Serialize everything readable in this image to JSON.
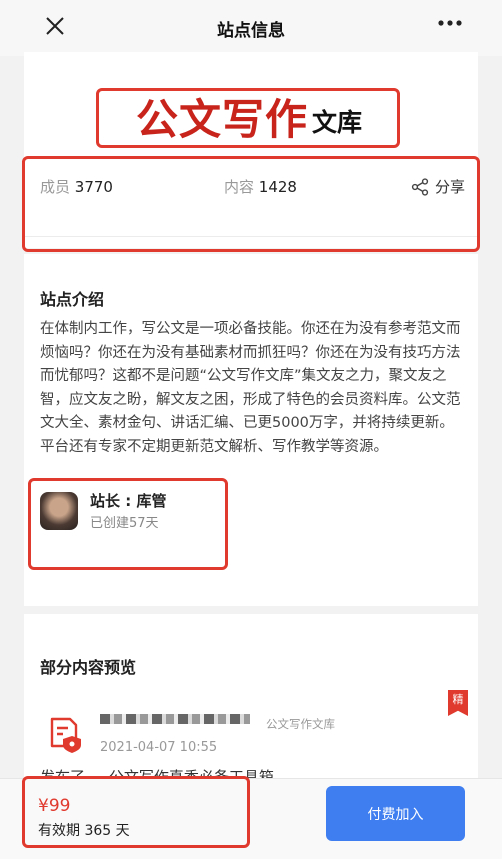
{
  "topbar": {
    "title": "站点信息",
    "close_icon": "close-icon",
    "more_icon": "more-icon"
  },
  "logo": {
    "main": "公文写作",
    "suffix": "文库"
  },
  "stats": {
    "members_label": "成员",
    "members_value": "3770",
    "content_label": "内容",
    "content_value": "1428",
    "share_label": "分享",
    "share_icon": "share-icon"
  },
  "intro": {
    "heading": "站点介绍",
    "text": "在体制内工作，写公文是一项必备技能。你还在为没有参考范文而烦恼吗？你还在为没有基础素材而抓狂吗？你还在为没有技巧方法而忧郁吗？这都不是问题“公文写作文库”集文友之力，聚文友之智，应文友之盼，解文友之困，形成了特色的会员资料库。公文范文大全、素材金句、讲话汇编、已更5000万字，并将持续更新。平台还有专家不定期更新范文解析、写作教学等资源。"
  },
  "owner": {
    "name": "站长 : 库管",
    "created": "已创建57天"
  },
  "preview": {
    "heading": "部分内容预览",
    "badge": "精",
    "post": {
      "site": "公文写作文库",
      "time": "2021-04-07 10:55",
      "text": "发布了 ... 公文写作真香必备工具箱"
    }
  },
  "bottom": {
    "price": "¥99",
    "validity": "有效期 365 天",
    "pay_button": "付费加入"
  },
  "colors": {
    "accent_red": "#e0392d",
    "button_blue": "#3e7ef0"
  }
}
